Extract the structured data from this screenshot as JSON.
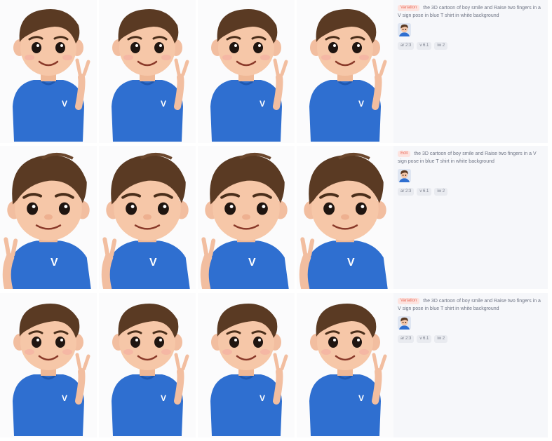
{
  "rows": [
    {
      "badge": "Variation",
      "prompt": "the 3D cartoon of boy smile and Raise two fingers in a V sign pose in blue T shirt in white background",
      "params": [
        "ar 2:3",
        "v 6.1",
        "iw 2"
      ],
      "colors": {
        "badge_bg": "#fde3df",
        "badge_fg": "#e86a5a"
      }
    },
    {
      "badge": "Edit",
      "prompt": "the 3D cartoon of boy smile and Raise two fingers in a V sign pose in blue T shirt in white background",
      "params": [
        "ar 2:3",
        "v 6.1",
        "iw 2"
      ],
      "colors": {
        "badge_bg": "#fde3df",
        "badge_fg": "#e86a5a"
      }
    },
    {
      "badge": "Variation",
      "prompt": "the 3D cartoon of boy smile and Raise two fingers in a V sign pose in blue T shirt in white background",
      "params": [
        "ar 2:3",
        "v 6.1",
        "iw 2"
      ],
      "colors": {
        "badge_bg": "#fde3df",
        "badge_fg": "#e86a5a"
      }
    }
  ],
  "palette": {
    "shirt": "#2f6fd0",
    "skin": "#f6c7a8",
    "hair": "#5a3a23",
    "panel": "#f6f7fa"
  }
}
